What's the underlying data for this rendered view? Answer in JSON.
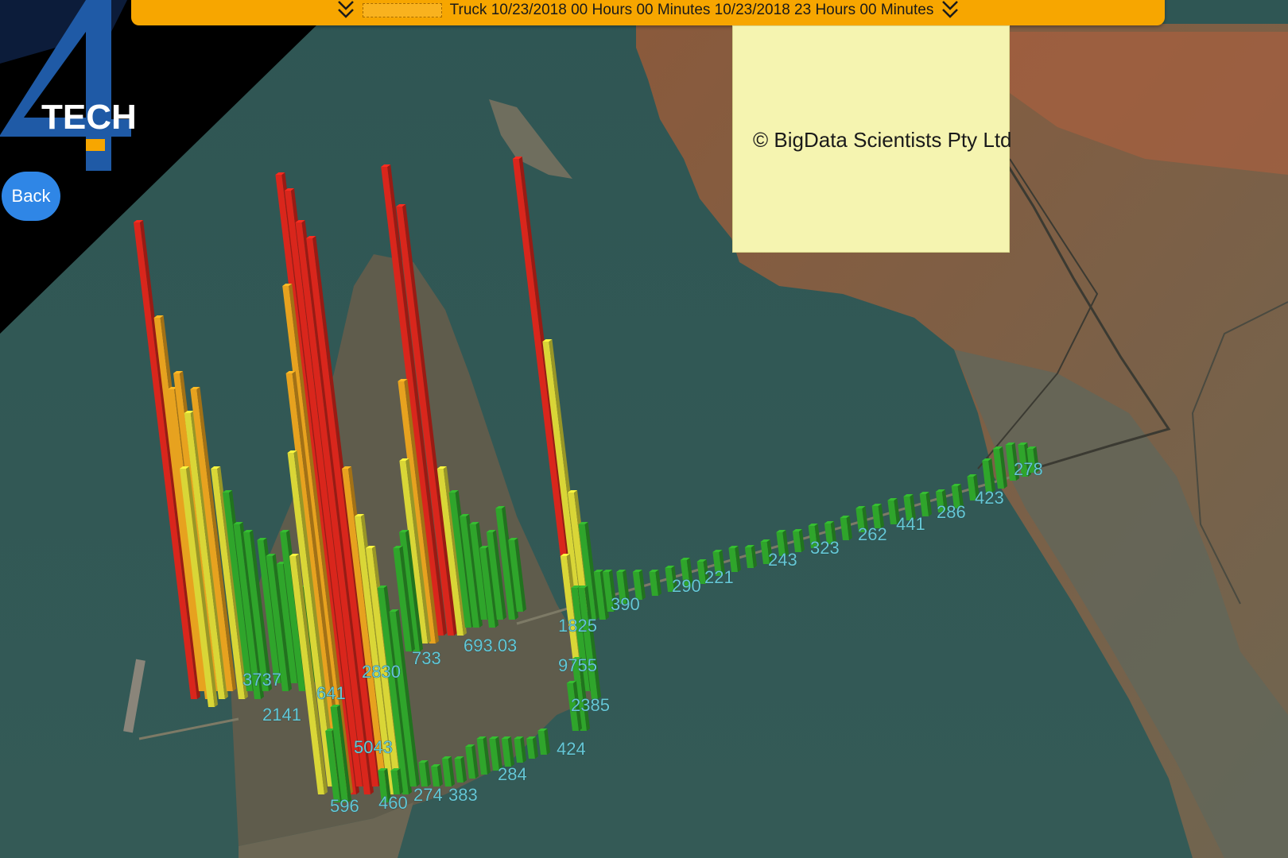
{
  "banner": {
    "text": "Truck 10/23/2018 00 Hours 00 Minutes 10/23/2018 23 Hours 00 Minutes"
  },
  "logo": {
    "text": "TECH",
    "mark": "4"
  },
  "back_button": {
    "label": "Back"
  },
  "note": {
    "text": "© BigData Scientists Pty Ltd"
  },
  "colors": {
    "banner": "#f7a600",
    "back_button": "#2f86e6",
    "note_panel": "#f5f4b0",
    "label_text": "#66c8d6",
    "bar_high": "#d9261c",
    "bar_mid": "#e7a21f",
    "bar_lowmid": "#d9d637",
    "bar_low": "#2fa52b"
  },
  "map_labels": [
    {
      "text": "3737"
    },
    {
      "text": "2141"
    },
    {
      "text": "641"
    },
    {
      "text": "2830"
    },
    {
      "text": "733"
    },
    {
      "text": "693.03"
    },
    {
      "text": "5043"
    },
    {
      "text": "596"
    },
    {
      "text": "460"
    },
    {
      "text": "274"
    },
    {
      "text": "383"
    },
    {
      "text": "284"
    },
    {
      "text": "424"
    },
    {
      "text": "2385"
    },
    {
      "text": "9755"
    },
    {
      "text": "1825"
    },
    {
      "text": "390"
    },
    {
      "text": "290"
    },
    {
      "text": "221"
    },
    {
      "text": "243"
    },
    {
      "text": "323"
    },
    {
      "text": "262"
    },
    {
      "text": "441"
    },
    {
      "text": "286"
    },
    {
      "text": "423"
    },
    {
      "text": "278"
    }
  ]
}
